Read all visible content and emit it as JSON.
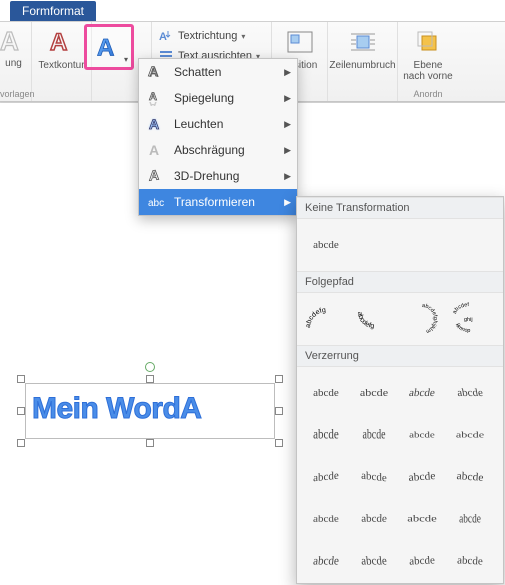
{
  "tab": {
    "label": "Formformat"
  },
  "ribbon": {
    "textkontur": "Textkontur",
    "textrichtung": "Textrichtung",
    "textausrichten": "Text ausrichten",
    "position": "Position",
    "zeilenumbruch": "Zeilenumbruch",
    "ebene": "Ebene\nnach vorne",
    "group_styles_suffix": "atvorlagen",
    "group_arrange_suffix": "Anordn",
    "truncated_left": "ung"
  },
  "dropdown": {
    "items": [
      {
        "label": "Schatten"
      },
      {
        "label": "Spiegelung"
      },
      {
        "label": "Leuchten"
      },
      {
        "label": "Abschrägung"
      },
      {
        "label": "3D-Drehung"
      },
      {
        "label": "Transformieren"
      }
    ]
  },
  "flyout": {
    "no_transform": "Keine Transformation",
    "sample_text": "abcde",
    "follow_path": "Folgepfad",
    "warp": "Verzerrung",
    "warp_sample": "abcde"
  },
  "wordart": {
    "text": "Mein WordA"
  }
}
